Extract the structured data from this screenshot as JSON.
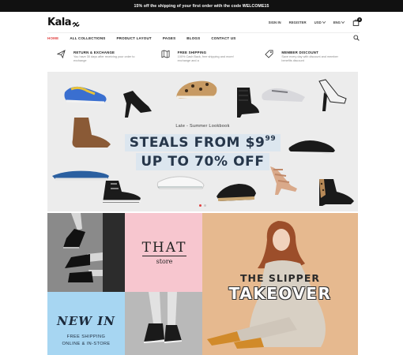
{
  "announcement": "15% off the shipping of your first order with the code WELCOME15",
  "brand": {
    "logo": "Kala"
  },
  "header": {
    "links": [
      "SIGN IN",
      "REGISTER"
    ],
    "currency": "USD",
    "language": "ENG",
    "cart_count": "0",
    "icons": [
      "chevron-down-icon",
      "shopping-bag-icon",
      "search-icon"
    ]
  },
  "nav": {
    "items": [
      "HOME",
      "ALL COLLECTIONS",
      "PRODUCT LAYOUT",
      "PAGES",
      "BLOGS",
      "CONTACT US"
    ],
    "active_color": "#e04040"
  },
  "features": [
    {
      "icon": "paper-plane-icon",
      "title": "RETURN & EXCHANGE",
      "desc": "You have 30 days after receiving your order to exchange"
    },
    {
      "icon": "map-icon",
      "title": "FREE SHIPPING",
      "desc": "100% Cash Back, free shipping and more! exchange and a"
    },
    {
      "icon": "tag-icon",
      "title": "MEMBER DISCOUNT",
      "desc": "Save every day with discount and member benefits discount"
    }
  ],
  "hero": {
    "eyebrow": "Late - Summer Lookbook",
    "headline1": "STEALS FROM $9",
    "headline1_sup": "99",
    "headline2": "UP TO 70% OFF",
    "slide_dots": 2,
    "active_dot_color": "#e04040",
    "highlight_color": "#dce6ef",
    "text_color": "#26364a"
  },
  "promo_that": {
    "title": "THAT",
    "subtitle": "store",
    "bg": "#f7c6cf"
  },
  "promo_newin": {
    "title": "NEW IN",
    "line1": "FREE SHIPPING",
    "line2": "ONLINE & IN-STORE",
    "bg": "#a7d6f2"
  },
  "promo_slipper": {
    "line1": "THE SLIPPER",
    "line2": "TAKEOVER",
    "bg": "#e6b98f"
  }
}
